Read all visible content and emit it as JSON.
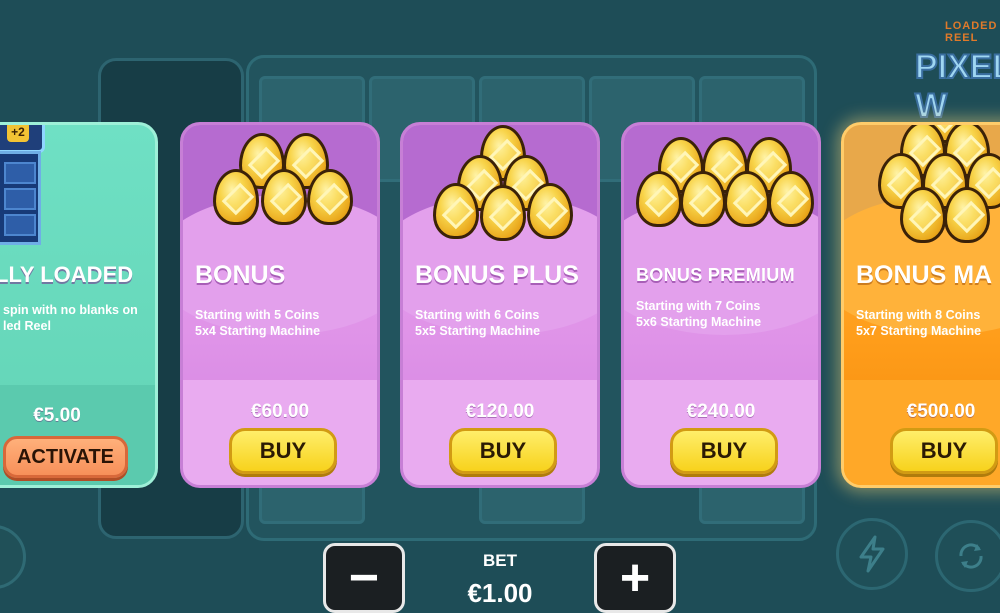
{
  "game": {
    "logo_top": "LOADED REEL",
    "logo_main": "PIXEL W"
  },
  "cards": [
    {
      "id": "fully-loaded",
      "title": "LLY LOADED",
      "desc_lines": [
        "spin with no blanks on",
        "led Reel"
      ],
      "price": "€5.00",
      "button": "ACTIVATE",
      "badge": "+2",
      "theme": "#62d3b5"
    },
    {
      "id": "bonus",
      "title": "BONUS",
      "desc_lines": [
        "Starting with 5 Coins",
        "5x4 Starting Machine"
      ],
      "price": "€60.00",
      "button": "BUY",
      "theme": "#df93e8"
    },
    {
      "id": "bonus-plus",
      "title": "BONUS PLUS",
      "desc_lines": [
        "Starting with 6 Coins",
        "5x5 Starting Machine"
      ],
      "price": "€120.00",
      "button": "BUY",
      "theme": "#df93e8"
    },
    {
      "id": "bonus-premium",
      "title": "BONUS PREMIUM",
      "desc_lines": [
        "Starting with 7 Coins",
        "5x6 Starting Machine"
      ],
      "price": "€240.00",
      "button": "BUY",
      "theme": "#df93e8"
    },
    {
      "id": "bonus-max",
      "title": "BONUS MA",
      "desc_lines": [
        "Starting with 8 Coins",
        "5x7 Starting Machine"
      ],
      "price": "€500.00",
      "button": "BUY",
      "theme": "#ff9d1a"
    }
  ],
  "bet": {
    "label": "BET",
    "value": "€1.00",
    "minus": "−",
    "plus": "+"
  },
  "icons": {
    "turbo": "lightning-icon",
    "autoplay": "autoplay-icon",
    "egg": "golden-egg-icon"
  }
}
